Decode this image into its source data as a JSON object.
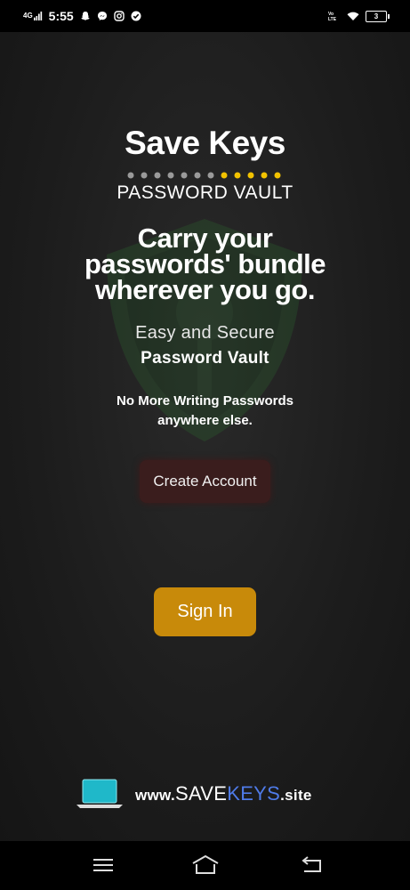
{
  "status_bar": {
    "network": "4G",
    "time": "5:55",
    "battery": "3"
  },
  "brand": {
    "title": "Save Keys",
    "subtitle": "PASSWORD VAULT"
  },
  "headline": "Carry your passwords' bundle wherever you go.",
  "tagline": {
    "line1": "Easy and Secure",
    "line2": "Password Vault"
  },
  "note": {
    "line1": "No More Writing Passwords",
    "line2": "anywhere else."
  },
  "buttons": {
    "create_account": "Create Account",
    "sign_in": "Sign In"
  },
  "website": {
    "prefix": "www.",
    "save": "SAVE",
    "keys": "KEYS",
    "suffix": ".site"
  },
  "colors": {
    "accent_gold": "#c88a0a",
    "dot_yellow": "#f2c200",
    "dot_gray": "#9a9a9a",
    "keys_blue": "#4f7be8",
    "shield_green": "#2e7d32"
  },
  "icons": [
    "snapchat-icon",
    "messenger-icon",
    "instagram-icon",
    "check-icon",
    "wifi-icon",
    "menu-icon",
    "home-icon",
    "back-icon",
    "laptop-icon",
    "shield-icon"
  ]
}
